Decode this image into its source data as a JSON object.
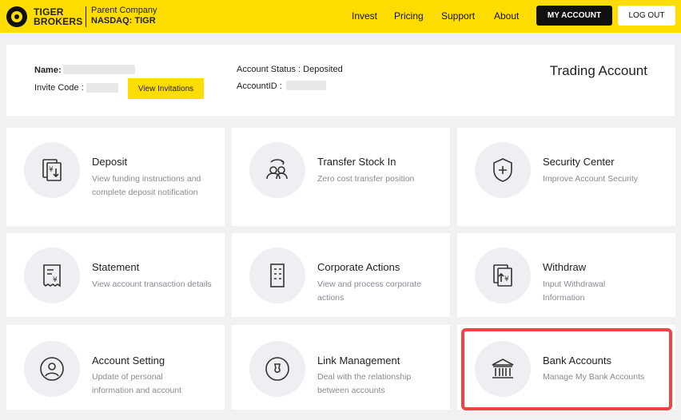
{
  "header": {
    "brand_line1": "TIGER",
    "brand_line2": "BROKERS",
    "parent_label": "Parent Company",
    "ticker": "NASDAQ: TIGR",
    "nav": [
      "Invest",
      "Pricing",
      "Support",
      "About"
    ],
    "my_account": "MY ACCOUNT",
    "logout": "LOG OUT"
  },
  "info": {
    "name_label": "Name:",
    "invite_label": "Invite Code :",
    "view_invitations": "View Invitations",
    "account_status": "Account Status : Deposited",
    "account_id_label": "AccountID :",
    "trading_account": "Trading Account"
  },
  "cards": [
    {
      "title": "Deposit",
      "desc": "View funding instructions and complete deposit notification",
      "icon": "deposit-icon"
    },
    {
      "title": "Transfer Stock In",
      "desc": "Zero cost transfer position",
      "icon": "transfer-icon"
    },
    {
      "title": "Security Center",
      "desc": "Improve Account Security",
      "icon": "shield-icon"
    },
    {
      "title": "Statement",
      "desc": "View account transaction details",
      "icon": "statement-icon"
    },
    {
      "title": "Corporate Actions",
      "desc": "View and process corporate actions",
      "icon": "building-icon"
    },
    {
      "title": "Withdraw",
      "desc": "Input Withdrawal Information",
      "icon": "withdraw-icon"
    },
    {
      "title": "Account Setting",
      "desc": "Update of personal information and account",
      "icon": "user-icon"
    },
    {
      "title": "Link Management",
      "desc": "Deal with the relationship between accounts",
      "icon": "link-icon"
    },
    {
      "title": "Bank Accounts",
      "desc": "Manage My Bank Accounts",
      "icon": "bank-icon"
    }
  ],
  "colors": {
    "accent": "#ffdd00",
    "highlight": "#ee4444"
  }
}
